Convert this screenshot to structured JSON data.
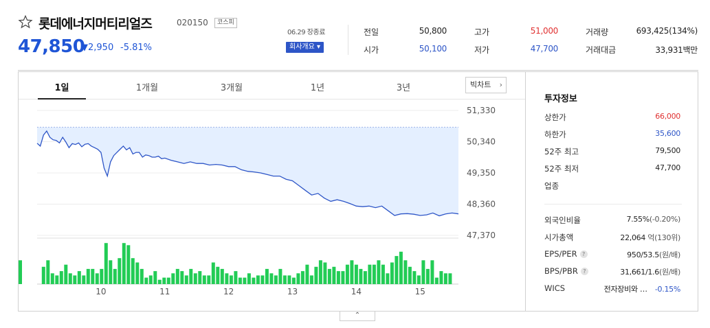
{
  "header": {
    "stock_name": "롯데에너지머티리얼즈",
    "stock_code": "020150",
    "market": "코스피",
    "price": "47,850",
    "change": "▼2,950",
    "change_pct": "-5.81%",
    "date_note": "06.29 장종료",
    "company_button": "회사개요 ▾"
  },
  "stats": {
    "prev_label": "전일",
    "prev": "50,800",
    "high_label": "고가",
    "high": "51,000",
    "volume_label": "거래량",
    "volume": "693,425(134%)",
    "open_label": "시가",
    "open": "50,100",
    "low_label": "저가",
    "low": "47,700",
    "amount_label": "거래대금",
    "amount": "33,931",
    "amount_unit": "백만"
  },
  "tabs": [
    "1일",
    "1개월",
    "3개월",
    "1년",
    "3년"
  ],
  "big_chart_label": "빅차트",
  "big_chart_arrow": "›",
  "info": {
    "title": "투자정보",
    "rows": [
      {
        "label": "상한가",
        "value": "66,000",
        "color": "#e03030"
      },
      {
        "label": "하한가",
        "value": "35,600",
        "color": "#2d55c7"
      },
      {
        "label": "52주 최고",
        "value": "79,500",
        "color": "#222"
      },
      {
        "label": "52주 최저",
        "value": "47,700",
        "color": "#222"
      },
      {
        "label": "업종",
        "value": "",
        "color": "#222"
      }
    ],
    "foreign_label": "외국인비율",
    "foreign_value": "7.55%",
    "foreign_change": "(-0.20%)",
    "mcap_label": "시가총액",
    "mcap_value": "22,064",
    "mcap_unit": "억(130위)",
    "eps_label": "EPS/PER",
    "eps_value": "950/53.5",
    "eps_unit": "(원/배)",
    "bps_label": "BPS/PBR",
    "bps_value": "31,661/1.6",
    "bps_unit": "(원/배)",
    "wics_label": "WICS",
    "wics_value": "전자장비와 …",
    "wics_change": "-0.15%",
    "help_glyph": "?"
  },
  "toggle_label": "⌃",
  "chart_data": {
    "type": "line",
    "title": "",
    "y_ticks": [
      "51,330",
      "50,340",
      "49,350",
      "48,360",
      "47,370"
    ],
    "y_tick_values": [
      51330,
      50340,
      49350,
      48360,
      47370
    ],
    "ylim": [
      47370,
      51330
    ],
    "x_ticks": [
      "10",
      "11",
      "12",
      "13",
      "14",
      "15"
    ],
    "x_tick_positions": [
      10,
      11,
      12,
      13,
      14,
      15
    ],
    "xlim": [
      9,
      15.6
    ],
    "prev_close": 50800,
    "x": [
      9.0,
      9.05,
      9.1,
      9.15,
      9.2,
      9.25,
      9.3,
      9.35,
      9.4,
      9.45,
      9.5,
      9.55,
      9.6,
      9.65,
      9.7,
      9.75,
      9.8,
      9.85,
      9.9,
      9.95,
      10.0,
      10.05,
      10.1,
      10.15,
      10.2,
      10.25,
      10.3,
      10.35,
      10.4,
      10.45,
      10.5,
      10.55,
      10.6,
      10.65,
      10.7,
      10.75,
      10.8,
      10.85,
      10.9,
      10.95,
      11.0,
      11.1,
      11.2,
      11.3,
      11.4,
      11.5,
      11.6,
      11.7,
      11.8,
      11.9,
      12.0,
      12.1,
      12.2,
      12.3,
      12.4,
      12.5,
      12.6,
      12.7,
      12.8,
      12.9,
      13.0,
      13.1,
      13.2,
      13.3,
      13.4,
      13.5,
      13.6,
      13.7,
      13.8,
      13.9,
      14.0,
      14.1,
      14.2,
      14.3,
      14.4,
      14.5,
      14.6,
      14.7,
      14.8,
      14.9,
      15.0,
      15.1,
      15.2,
      15.3,
      15.4,
      15.5,
      15.6
    ],
    "values": [
      50290,
      50200,
      50550,
      50680,
      50480,
      50400,
      50380,
      50300,
      50480,
      50330,
      50150,
      50280,
      50250,
      50300,
      50180,
      50260,
      50280,
      50200,
      50150,
      50100,
      50000,
      49500,
      49250,
      49700,
      49900,
      50000,
      50100,
      50200,
      50080,
      50150,
      49950,
      50000,
      50000,
      49850,
      49920,
      49900,
      49850,
      49850,
      49880,
      49800,
      49820,
      49750,
      49700,
      49650,
      49700,
      49650,
      49650,
      49600,
      49620,
      49600,
      49550,
      49550,
      49450,
      49400,
      49380,
      49350,
      49300,
      49250,
      49250,
      49150,
      49100,
      48950,
      48800,
      48650,
      48700,
      48550,
      48450,
      48500,
      48450,
      48380,
      48300,
      48280,
      48300,
      48250,
      48300,
      48150,
      48000,
      48050,
      48060,
      48040,
      48000,
      48020,
      48080,
      47990,
      48050,
      48080,
      48050
    ],
    "volume_x": [
      9.1,
      9.17,
      9.24,
      9.31,
      9.38,
      9.45,
      9.52,
      9.59,
      9.66,
      9.73,
      9.8,
      9.87,
      9.94,
      10.01,
      10.08,
      10.15,
      10.22,
      10.29,
      10.36,
      10.43,
      10.5,
      10.57,
      10.64,
      10.71,
      10.78,
      10.85,
      10.92,
      10.99,
      11.06,
      11.13,
      11.2,
      11.27,
      11.34,
      11.41,
      11.48,
      11.55,
      11.62,
      11.69,
      11.76,
      11.83,
      11.9,
      11.97,
      12.04,
      12.11,
      12.18,
      12.25,
      12.32,
      12.39,
      12.46,
      12.53,
      12.6,
      12.67,
      12.74,
      12.81,
      12.88,
      12.95,
      13.02,
      13.09,
      13.16,
      13.23,
      13.3,
      13.37,
      13.44,
      13.51,
      13.58,
      13.65,
      13.72,
      13.79,
      13.86,
      13.93,
      14.0,
      14.07,
      14.14,
      14.21,
      14.28,
      14.35,
      14.42,
      14.49,
      14.56,
      14.63,
      14.7,
      14.77,
      14.84,
      14.91,
      14.98,
      15.05,
      15.12,
      15.19,
      15.26,
      15.33,
      15.4,
      15.47
    ],
    "volumes": [
      0.4,
      0.55,
      0.25,
      0.2,
      0.3,
      0.45,
      0.25,
      0.2,
      0.3,
      0.2,
      0.35,
      0.35,
      0.25,
      0.35,
      0.95,
      0.55,
      0.35,
      0.6,
      0.95,
      0.9,
      0.6,
      0.5,
      0.35,
      0.15,
      0.2,
      0.3,
      0.1,
      0.15,
      0.15,
      0.25,
      0.35,
      0.3,
      0.2,
      0.35,
      0.25,
      0.3,
      0.2,
      0.2,
      0.5,
      0.4,
      0.35,
      0.25,
      0.2,
      0.3,
      0.15,
      0.15,
      0.25,
      0.15,
      0.2,
      0.2,
      0.35,
      0.25,
      0.2,
      0.35,
      0.2,
      0.2,
      0.15,
      0.25,
      0.3,
      0.45,
      0.2,
      0.4,
      0.55,
      0.5,
      0.35,
      0.4,
      0.3,
      0.3,
      0.45,
      0.55,
      0.45,
      0.35,
      0.3,
      0.45,
      0.45,
      0.55,
      0.45,
      0.25,
      0.5,
      0.65,
      0.75,
      0.55,
      0.4,
      0.3,
      0.2,
      0.55,
      0.35,
      0.55,
      0.15,
      0.3,
      0.25,
      0.25,
      0.55
    ],
    "line_color": "#2d55c7",
    "fill_color": "#e4efff",
    "volume_color": "#22cc55"
  }
}
